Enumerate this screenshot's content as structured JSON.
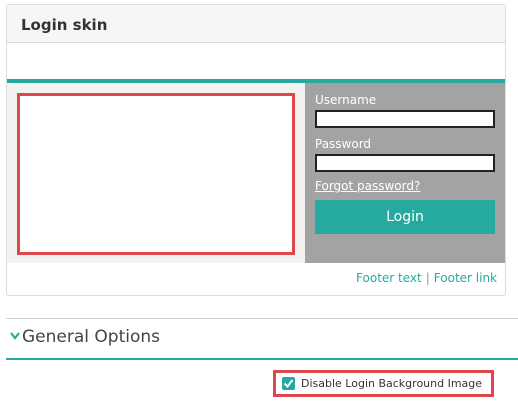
{
  "panel": {
    "title": "Login skin"
  },
  "login_form": {
    "username_label": "Username",
    "username_value": "",
    "password_label": "Password",
    "password_value": "",
    "forgot_link": "Forgot password?",
    "login_button": "Login"
  },
  "footer": {
    "text": "Footer text",
    "separator": "|",
    "link": "Footer link"
  },
  "general_options": {
    "header": "General Options",
    "disable_bg_label": "Disable Login Background Image",
    "disable_bg_checked": true
  },
  "icons": {
    "section_toggle": "chevron-down-icon",
    "checkbox": "check-icon"
  },
  "colors": {
    "accent": "#26aaa0",
    "highlight": "#e0474c",
    "login_panel": "#a3a3a3"
  }
}
